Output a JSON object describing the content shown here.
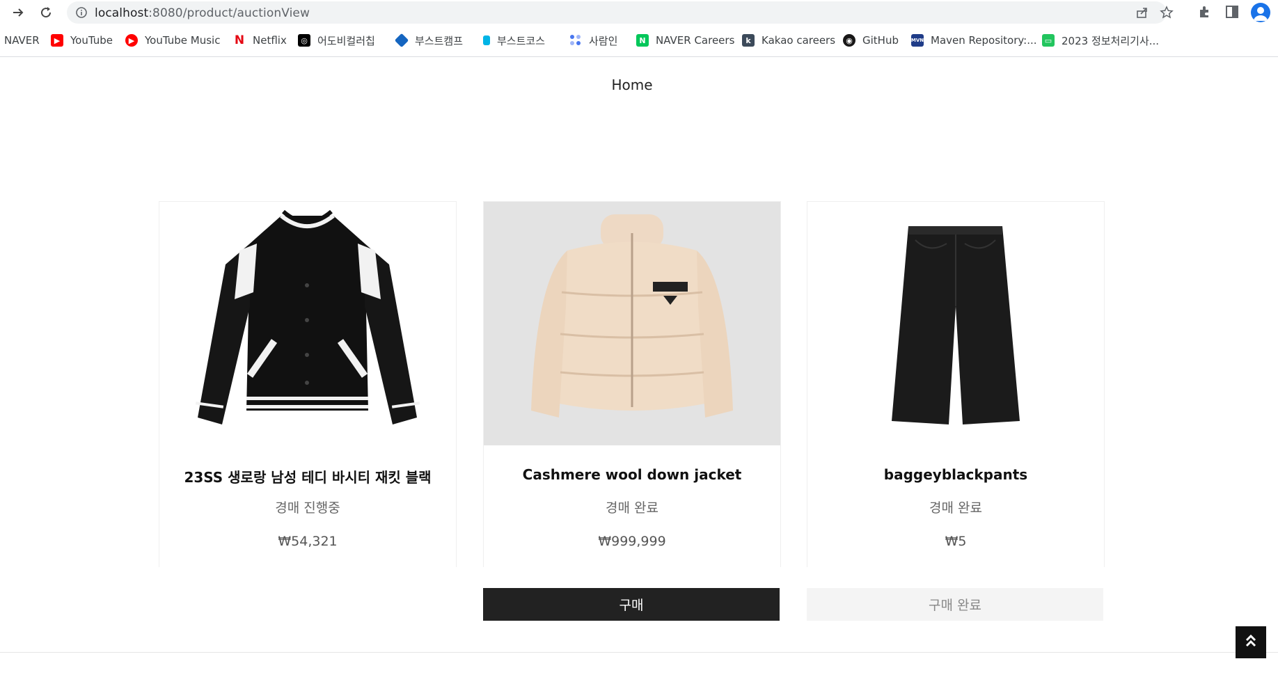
{
  "browser": {
    "url_host": "localhost",
    "url_path": ":8080/product/auctionView",
    "bookmarks": [
      {
        "label": "NAVER",
        "icon": "naver-text",
        "color": ""
      },
      {
        "label": "YouTube",
        "icon": "youtube-icon",
        "color": "#ff0000"
      },
      {
        "label": "YouTube Music",
        "icon": "youtube-music-icon",
        "color": "#ff0000"
      },
      {
        "label": "Netflix",
        "icon": "netflix-icon",
        "color": "#e50914"
      },
      {
        "label": "어도비컬러칩",
        "icon": "adobe-color-icon",
        "color": "#000000"
      },
      {
        "label": "부스트캠프",
        "icon": "cube-icon",
        "color": "#1565c0"
      },
      {
        "label": "부스트코스",
        "icon": "boostcourse-icon",
        "color": "#00b4e6"
      },
      {
        "label": "사람인",
        "icon": "saramin-icon",
        "color": "#4876ef"
      },
      {
        "label": "NAVER Careers",
        "icon": "naver-n-icon",
        "color": "#03c75a"
      },
      {
        "label": "Kakao careers",
        "icon": "kakao-k-icon",
        "color": "#3c4a5a"
      },
      {
        "label": "GitHub",
        "icon": "github-icon",
        "color": "#181717"
      },
      {
        "label": "Maven Repository:...",
        "icon": "maven-icon",
        "color": "#1f3c88"
      },
      {
        "label": "2023 정보처리기사...",
        "icon": "chat-icon",
        "color": "#22c55e"
      }
    ]
  },
  "page": {
    "home_label": "Home"
  },
  "products": [
    {
      "name": "23SS 생로랑 남성 테디 바시티 재킷 블랙",
      "status": "경매 진행중",
      "price": "₩54,321",
      "image": "varsity-jacket"
    },
    {
      "name": "Cashmere wool down jacket",
      "status": "경매 완료",
      "price": "₩999,999",
      "image": "down-jacket"
    },
    {
      "name": "baggeyblackpants",
      "status": "경매 완료",
      "price": "₩5",
      "image": "black-pants"
    }
  ],
  "actions": {
    "buy_label": "구매",
    "done_label": "구매 완료"
  },
  "colors": {
    "button_dark": "#222222",
    "button_disabled": "#f4f4f4"
  }
}
